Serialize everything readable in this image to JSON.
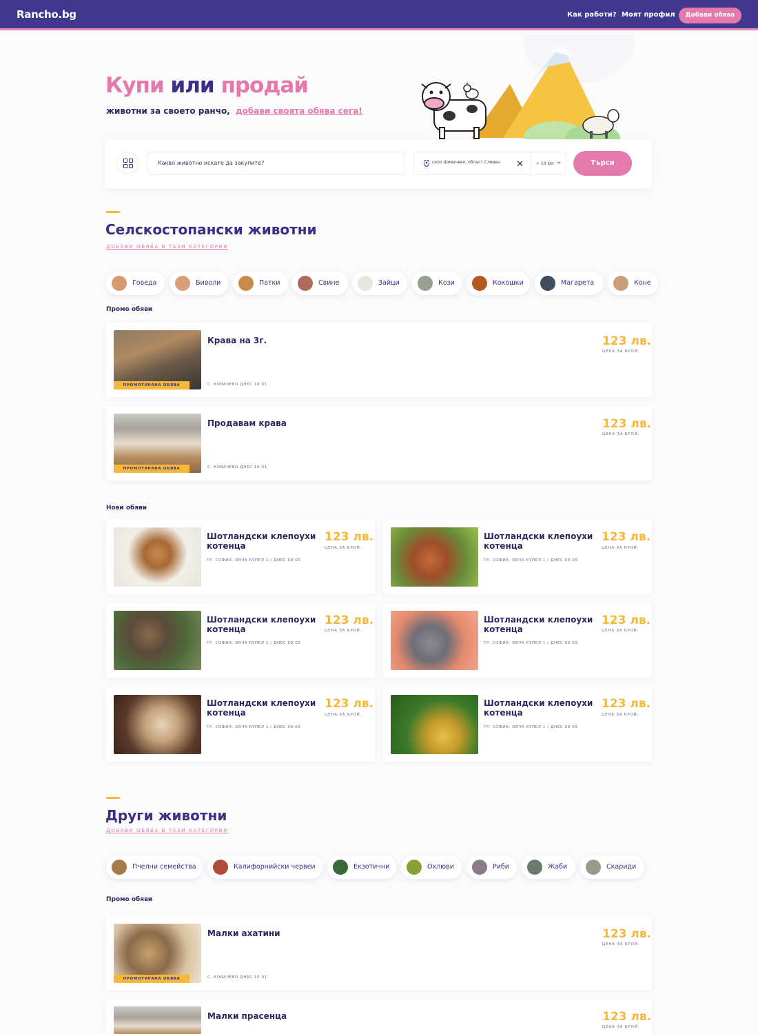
{
  "header": {
    "logo": "Rancho.bg",
    "nav": [
      "Как работи?",
      "Моят профил"
    ],
    "add_button": "Добави обява"
  },
  "hero": {
    "title_buy": "Купи",
    "title_or": "или",
    "title_sell": "продай",
    "subtitle": "животни за своето ранчо,",
    "subtitle_link": "добави своята обява сега!"
  },
  "search": {
    "placeholder": "Какво животно искате да закупите?",
    "location": "село Шивачево, област Сливен",
    "radius": "+ 10 km",
    "button": "Търси"
  },
  "farm_section": {
    "title": "Селскостопански животни",
    "add_link": "ДОБАВИ ОБЯВА В ТАЗИ КАТЕГОРИЯ",
    "categories": [
      "Говеда",
      "Биволи",
      "Патки",
      "Свине",
      "Зайци",
      "Кози",
      "Кокошки",
      "Магарета",
      "Коне"
    ],
    "promo_label": "Промо обяви",
    "promo": [
      {
        "title": "Крава на 3г.",
        "meta": "С. КОВАЧЕВО ДНЕС 10:01",
        "price": "123 лв.",
        "unit": "ЦЕНА ЗА БРОЙ.",
        "tag": "ПРОМОТИРАНА ОБЯВА"
      },
      {
        "title": "Продавам крава",
        "meta": "С. КОВАЧЕВО ДНЕС 10:01",
        "price": "123 лв.",
        "unit": "ЦЕНА ЗА БРОЙ.",
        "tag": "ПРОМОТИРАНА ОБЯВА"
      }
    ],
    "new_label": "Нови обяви",
    "new": [
      {
        "title": "Шотландски клепоухи котенца",
        "meta": "ГР. СОФИЯ, ОВЧА КУПЕЛ 1 / ДНЕС 09:05",
        "price": "123 лв.",
        "unit": "ЦЕНА ЗА БРОЙ."
      },
      {
        "title": "Шотландски клепоухи котенца",
        "meta": "ГР. СОФИЯ, ОВЧА КУПЕЛ 1 / ДНЕС 09:05",
        "price": "123 лв.",
        "unit": "ЦЕНА ЗА БРОЙ."
      },
      {
        "title": "Шотландски клепоухи котенца",
        "meta": "ГР. СОФИЯ, ОВЧА КУПЕЛ 1 / ДНЕС 09:05",
        "price": "123 лв.",
        "unit": "ЦЕНА ЗА БРОЙ."
      },
      {
        "title": "Шотландски клепоухи котенца",
        "meta": "ГР. СОФИЯ, ОВЧА КУПЕЛ 1 / ДНЕС 09:05",
        "price": "123 лв.",
        "unit": "ЦЕНА ЗА БРОЙ."
      },
      {
        "title": "Шотландски клепоухи котенца",
        "meta": "ГР. СОФИЯ, ОВЧА КУПЕЛ 1 / ДНЕС 09:05",
        "price": "123 лв.",
        "unit": "ЦЕНА ЗА БРОЙ."
      },
      {
        "title": "Шотландски клепоухи котенца",
        "meta": "ГР. СОФИЯ, ОВЧА КУПЕЛ 1 / ДНЕС 09:05",
        "price": "123 лв.",
        "unit": "ЦЕНА ЗА БРОЙ."
      }
    ]
  },
  "other_section": {
    "title": "Други животни",
    "add_link": "ДОБАВИ ОБЯВА В ТАЗИ КАТЕГОРИЯ",
    "categories": [
      "Пчелни семейства",
      "Калифорнийски червеи",
      "Екзотични",
      "Охлюви",
      "Риби",
      "Жаби",
      "Скариди"
    ],
    "promo_label": "Промо обяви",
    "promo": [
      {
        "title": "Малки ахатини",
        "meta": "С. КОВАЧЕВО ДНЕС 10:01",
        "price": "123 лв.",
        "unit": "ЦЕНА ЗА БРОЙ.",
        "tag": "ПРОМОТИРАНА ОБЯВА"
      },
      {
        "title": "Малки прасенца",
        "meta": "",
        "price": "123 лв.",
        "unit": "ЦЕНА ЗА БРОЙ."
      }
    ]
  },
  "colors": {
    "brand": "#41378f",
    "accent_pink": "#e47aac",
    "accent_yellow": "#f5b83a"
  }
}
